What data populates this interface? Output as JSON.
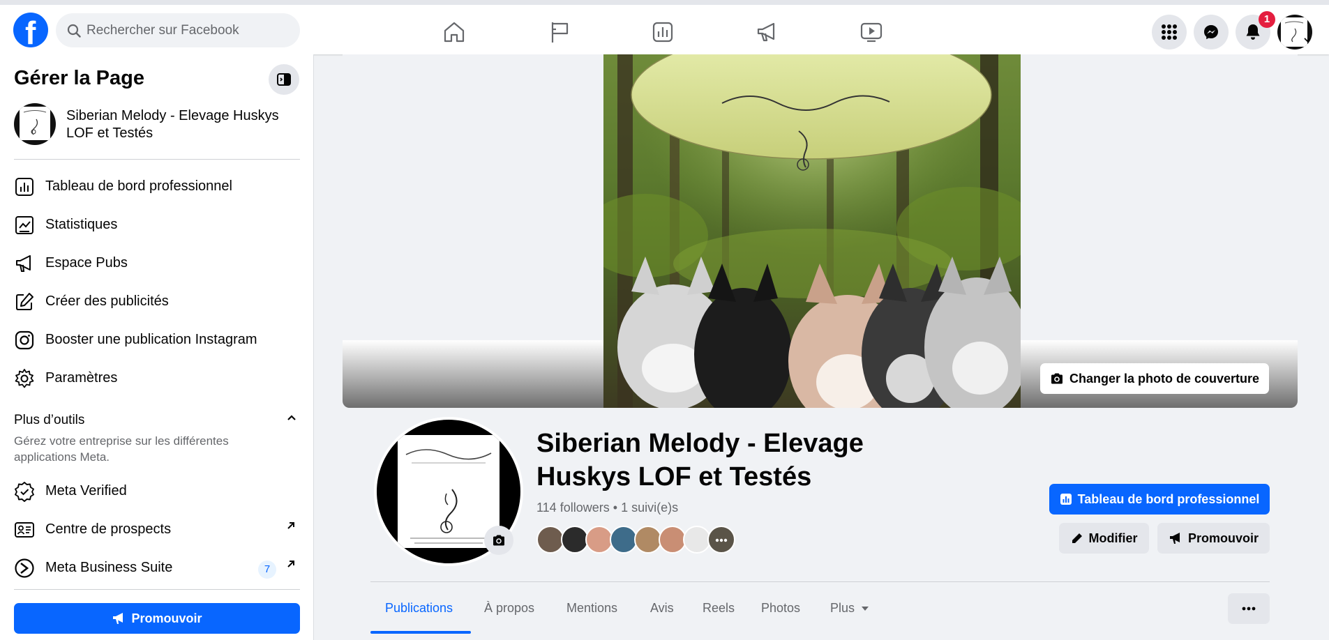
{
  "topbar": {
    "search_placeholder": "Rechercher sur Facebook",
    "notification_count": "1",
    "nav_icons": [
      "home-icon",
      "flag-icon",
      "dashboard-icon",
      "megaphone-icon",
      "video-icon"
    ],
    "right_icons": [
      "apps-grid-icon",
      "messenger-icon",
      "bell-icon"
    ]
  },
  "sidebar": {
    "title": "Gérer la Page",
    "page_name": "Siberian Melody - Elevage Huskys LOF et Testés",
    "items": [
      {
        "label": "Tableau de bord professionnel",
        "icon": "dashboard-icon"
      },
      {
        "label": "Statistiques",
        "icon": "insights-icon"
      },
      {
        "label": "Espace Pubs",
        "icon": "megaphone-icon"
      },
      {
        "label": "Créer des publicités",
        "icon": "edit-icon"
      },
      {
        "label": "Booster une publication Instagram",
        "icon": "instagram-icon"
      },
      {
        "label": "Paramètres",
        "icon": "gear-icon"
      }
    ],
    "section_title": "Plus d’outils",
    "section_desc": "Gérez votre entreprise sur les différentes applications Meta.",
    "tools": [
      {
        "label": "Meta Verified",
        "icon": "verified-badge-icon"
      },
      {
        "label": "Centre de prospects",
        "icon": "contact-card-icon"
      },
      {
        "label": "Meta Business Suite",
        "icon": "business-suite-icon",
        "badge": "7"
      }
    ],
    "promote_label": "Promouvoir"
  },
  "cover": {
    "logo_text": "Siberian Melody",
    "change_label": "Changer la photo de couverture"
  },
  "profile": {
    "logo_text": "Siberian Melody",
    "name": "Siberian Melody - Elevage Huskys LOF et Testés",
    "followers": "114 followers",
    "separator": "•",
    "following": "1 suivi(e)s"
  },
  "actions": {
    "dashboard_label": "Tableau de bord professionnel",
    "edit_label": "Modifier",
    "promote_label": "Promouvoir"
  },
  "tabs": {
    "items": [
      "Publications",
      "À propos",
      "Mentions",
      "Avis",
      "Reels",
      "Photos",
      "Plus"
    ],
    "active": "Publications"
  },
  "colors": {
    "brand_blue": "#0866ff",
    "badge_red": "#e41e3f",
    "button_grey": "#e4e6eb",
    "text_secondary": "#65676b"
  }
}
